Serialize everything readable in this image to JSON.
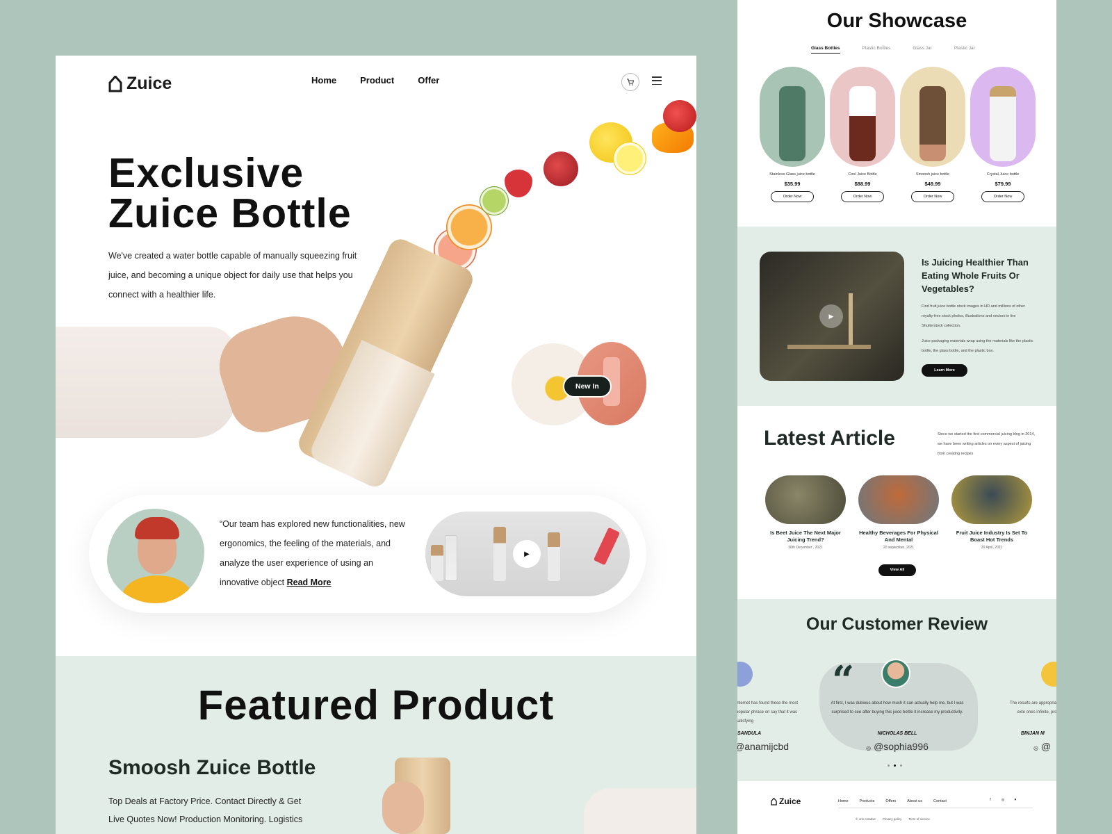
{
  "colors": {
    "page_bg": "#adc5bb",
    "mint": "#e3ede8",
    "dark": "#17201d"
  },
  "left": {
    "logo": "Zuice",
    "nav": [
      "Home",
      "Product",
      "Offer"
    ],
    "icons": [
      "cart-icon",
      "menu-icon"
    ],
    "hero": {
      "title_line1": "Exclusive",
      "title_line2": "Zuice Bottle",
      "description": "We've created a water bottle capable of manually squeezing fruit juice, and becoming a unique object for daily use that helps you connect with a healthier life."
    },
    "new_in_label": "New In",
    "testimonial": {
      "quote": "“Our team has explored new functionalities, new ergonomics, the feeling of the materials, and analyze the user experience of using an innovative object",
      "link": "Read More"
    },
    "featured": {
      "title": "Featured Product",
      "product_name": "Smoosh Zuice Bottle",
      "description": "Top Deals at Factory Price. Contact Directly & Get Live Quotes Now! Production Monitoring. Logistics"
    }
  },
  "right": {
    "showcase": {
      "title": "Our Showcase",
      "tabs": [
        "Glass Bottles",
        "Plastic Bottles",
        "Glass Jar",
        "Plastic Jar"
      ],
      "active_tab": "Glass Bottles",
      "products": [
        {
          "name": "Stainless Glass juice bottle",
          "price": "$35.99",
          "button": "Order Now",
          "bg": "#a8c4b5",
          "bottle": "#4e7a66"
        },
        {
          "name": "Cool Juice Bottle",
          "price": "$88.99",
          "button": "Order Now",
          "bg": "#ebc6c6",
          "bottle": "#6b2a1d"
        },
        {
          "name": "Smoosh juice bottle",
          "price": "$49.99",
          "button": "Order Now",
          "bg": "#ecdcb5",
          "bottle": "#6e4f38"
        },
        {
          "name": "Crystal Juice bottle",
          "price": "$79.99",
          "button": "Order Now",
          "bg": "#dbb8ef",
          "bottle": "#f3f3f3"
        }
      ]
    },
    "blog": {
      "heading": "Is Juicing Healthier Than Eating Whole Fruits Or Vegetables?",
      "para1": "Find fruit juice bottle stock images in HD and millions of other royalty-free stock photos, illustrations and vectors in the Shutterstock collection.",
      "para2": "Juice packaging materials wrap using the materials like the plastic bottle, the glass bottle, and the plastic box.",
      "button": "Learn More"
    },
    "articles": {
      "title": "Latest Article",
      "intro": "Since we started the first commercial juicing blog in 2014, we have been writing articles on every aspect of juicing from creating recipes",
      "items": [
        {
          "title": "Is Beet Juice The Next Major Juicing Trend?",
          "date": "30th December , 2021",
          "color": "#6b6a52"
        },
        {
          "title": "Healthy Beverages For Physical And Mental",
          "date": "20 september, 2021",
          "color": "#7a8a92"
        },
        {
          "title": "Fruit Juice Industry Is Set To Boast Hot Trends",
          "date": "20 April, 2021",
          "color": "#8e8a3e"
        }
      ],
      "button": "View All"
    },
    "reviews": {
      "title": "Our Customer Review",
      "main": {
        "text": "At first, I was dubious about how much it can actually help me, but I was surprised to see after buying this juice bottle it increase my productivity.",
        "name": "NICHOLAS BELL",
        "handle": "@sophia996"
      },
      "left": {
        "text": "internet has found these the most popular phrase on say that it was satisfying",
        "name": "SANDULA",
        "handle": "@anamijcbd"
      },
      "right": {
        "text": "The results are appropriate exte ones infinite, provi",
        "name": "BINJAN M",
        "handle": "@"
      }
    },
    "footer": {
      "logo": "Zuice",
      "nav": [
        "Home",
        "Products",
        "Offers",
        "About us",
        "Contact"
      ],
      "social": [
        "f",
        "◎",
        "♥"
      ],
      "legal": [
        "© oris creative",
        "Privacy policy",
        "Term of service"
      ]
    }
  }
}
